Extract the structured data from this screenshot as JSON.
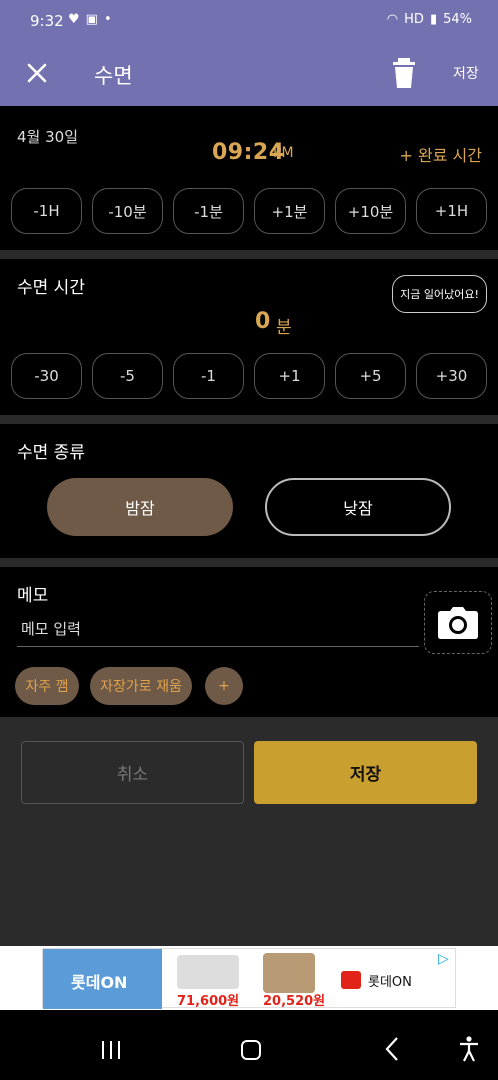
{
  "status_bar": {
    "time": "9:32",
    "battery": "54%",
    "network": "HD"
  },
  "app_bar": {
    "title": "수면",
    "save_label": "저장"
  },
  "start_section": {
    "date": "4월 30일",
    "time": "09:24",
    "ampm": "PM",
    "complete_time_label": "+ 완료 시간",
    "adjust_buttons": [
      "-1H",
      "-10분",
      "-1분",
      "+1분",
      "+10분",
      "+1H"
    ]
  },
  "duration_section": {
    "title": "수면 시간",
    "woke_button": "지금 일어났어요!",
    "value": "0",
    "unit": "분",
    "adjust_buttons": [
      "-30",
      "-5",
      "-1",
      "+1",
      "+5",
      "+30"
    ]
  },
  "type_section": {
    "title": "수면 종류",
    "options": [
      "밤잠",
      "낮잠"
    ],
    "selected": "밤잠"
  },
  "memo_section": {
    "title": "메모",
    "placeholder": "메모 입력",
    "chips": [
      "자주 깸",
      "자장가로 재움",
      "+"
    ]
  },
  "actions": {
    "cancel": "취소",
    "save": "저장"
  },
  "ad": {
    "banner": "롯데ON",
    "price1": "71,600원",
    "price2": "20,520원",
    "brand": "롯데ON"
  },
  "colors": {
    "header": "#7471b0",
    "accent": "#d9a654",
    "save": "#c9a02f",
    "chip": "#6e5a47"
  }
}
